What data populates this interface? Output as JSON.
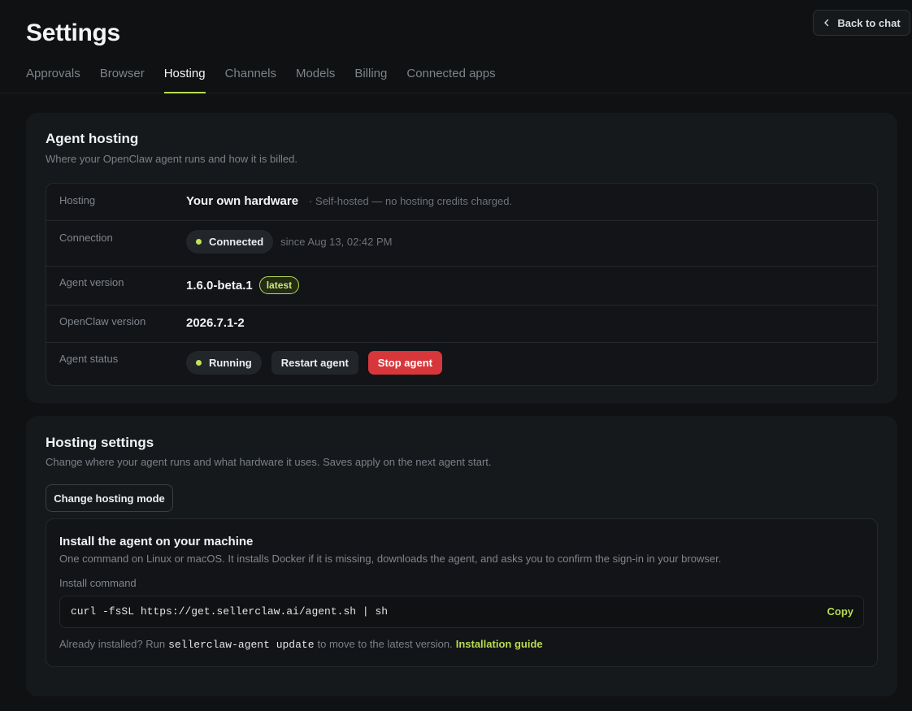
{
  "page": {
    "title": "Settings"
  },
  "header": {
    "back_label": "Back to chat"
  },
  "tabs": [
    {
      "label": "Approvals"
    },
    {
      "label": "Browser"
    },
    {
      "label": "Hosting",
      "active": true
    },
    {
      "label": "Channels"
    },
    {
      "label": "Models"
    },
    {
      "label": "Billing"
    },
    {
      "label": "Connected apps"
    }
  ],
  "agent_hosting": {
    "title": "Agent hosting",
    "subtitle": "Where your OpenClaw agent runs and how it is billed.",
    "hosting": {
      "label": "Hosting",
      "value": "Your own hardware",
      "note": "· Self-hosted — no hosting credits charged."
    },
    "connection": {
      "label": "Connection",
      "status": "Connected",
      "since": "since Aug 13, 02:42 PM"
    },
    "agent_version": {
      "label": "Agent version",
      "value": "1.6.0-beta.1",
      "tag": "latest"
    },
    "openclaw_version": {
      "label": "OpenClaw version",
      "value": "2026.7.1-2"
    },
    "agent_status": {
      "label": "Agent status",
      "status": "Running",
      "restart_label": "Restart agent",
      "stop_label": "Stop agent"
    }
  },
  "hosting_settings": {
    "title": "Hosting settings",
    "subtitle": "Change where your agent runs and what hardware it uses. Saves apply on the next agent start.",
    "change_mode_label": "Change hosting mode",
    "install": {
      "title": "Install the agent on your machine",
      "description": "One command on Linux or macOS. It installs Docker if it is missing, downloads the agent, and asks you to confirm the sign-in in your browser.",
      "command_label": "Install command",
      "command": "curl -fsSL https://get.sellerclaw.ai/agent.sh | sh",
      "copy_label": "Copy",
      "footer_prefix": "Already installed? Run",
      "footer_code": "sellerclaw-agent update",
      "footer_suffix": "to move to the latest version.",
      "guide_label": "Installation guide"
    }
  },
  "colors": {
    "accent": "#b8db52",
    "danger": "#d7373b",
    "status_dot": "#c2e359"
  },
  "icons": {
    "back": "chevron-left-icon",
    "status": "status-dot-icon"
  }
}
